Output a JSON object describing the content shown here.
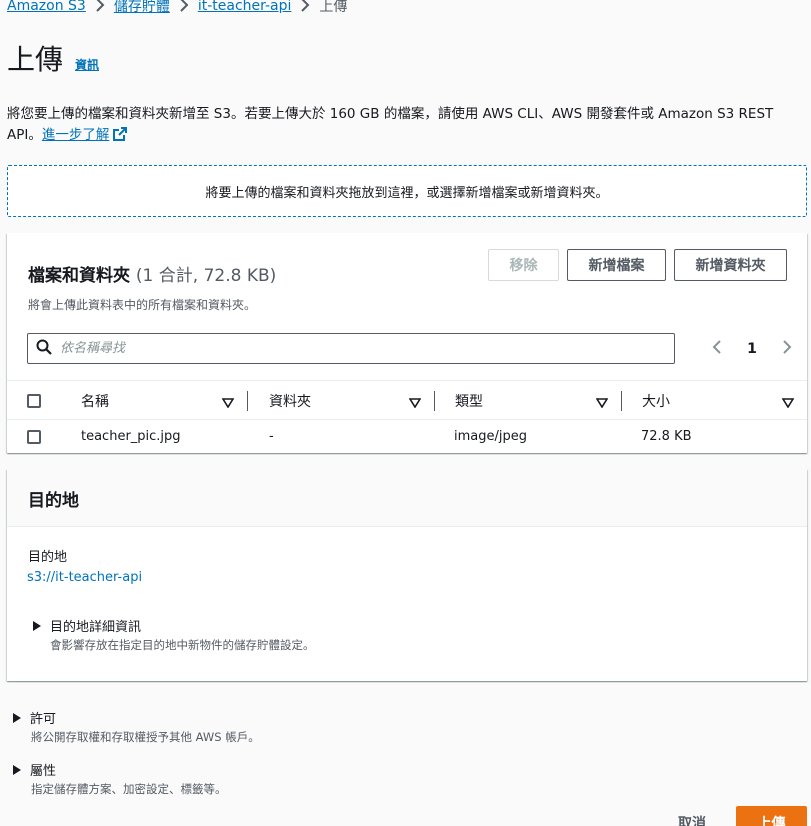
{
  "breadcrumb": {
    "items": [
      "Amazon S3",
      "儲存貯體",
      "it-teacher-api"
    ],
    "current": "上傳"
  },
  "page": {
    "title": "上傳",
    "info_link": "資訊",
    "description": "將您要上傳的檔案和資料夾新增至 S3。若要上傳大於 160 GB 的檔案，請使用 AWS CLI、AWS 開發套件或 Amazon S3 REST API。",
    "learn_more": "進一步了解"
  },
  "dropzone": {
    "text": "將要上傳的檔案和資料夾拖放到這裡，或選擇新增檔案或新增資料夾。"
  },
  "files": {
    "title": "檔案和資料夾",
    "count": "(1 合計, 72.8 KB)",
    "subtitle": "將會上傳此資料表中的所有檔案和資料夾。",
    "remove_label": "移除",
    "add_files_label": "新增檔案",
    "add_folder_label": "新增資料夾",
    "search_placeholder": "依名稱尋找",
    "page_number": "1",
    "columns": [
      "名稱",
      "資料夾",
      "類型",
      "大小"
    ],
    "rows": [
      {
        "name": "teacher_pic.jpg",
        "folder": "-",
        "type": "image/jpeg",
        "size": "72.8 KB"
      }
    ]
  },
  "destination": {
    "title": "目的地",
    "label": "目的地",
    "value": "s3://it-teacher-api",
    "details_label": "目的地詳細資訊",
    "details_desc": "會影響存放在指定目的地中新物件的儲存貯體設定。"
  },
  "permissions": {
    "label": "許可",
    "desc": "將公開存取權和存取權授予其他 AWS 帳戶。"
  },
  "properties": {
    "label": "屬性",
    "desc": "指定儲存體方案、加密設定、標籤等。"
  },
  "footer": {
    "cancel_label": "取消",
    "upload_label": "上傳"
  },
  "colors": {
    "link": "#0073bb",
    "primary": "#ec7211",
    "text": "#16191f",
    "muted": "#545b64"
  }
}
